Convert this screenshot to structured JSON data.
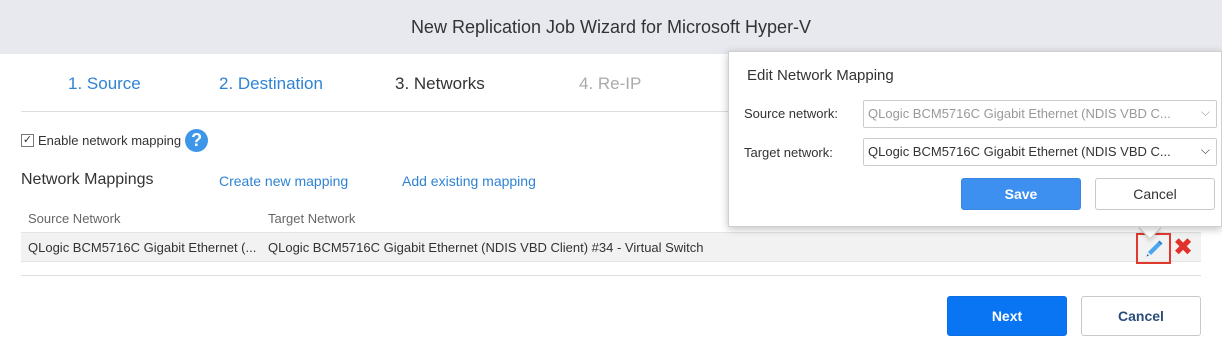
{
  "window": {
    "title": "New Replication Job Wizard for Microsoft Hyper-V"
  },
  "steps": [
    {
      "label": "1. Source",
      "state": "done"
    },
    {
      "label": "2. Destination",
      "state": "done"
    },
    {
      "label": "3. Networks",
      "state": "active"
    },
    {
      "label": "4. Re-IP",
      "state": "disabled"
    }
  ],
  "network_mapping": {
    "enable_label": "Enable network mapping",
    "enabled": true,
    "title": "Network Mappings",
    "create_link": "Create new mapping",
    "add_link": "Add existing mapping",
    "columns": {
      "source": "Source Network",
      "target": "Target Network"
    },
    "rows": [
      {
        "source": "QLogic BCM5716C Gigabit Ethernet (...",
        "target": "QLogic BCM5716C Gigabit Ethernet (NDIS VBD Client) #34 - Virtual Switch"
      }
    ]
  },
  "footer": {
    "next_label": "Next",
    "cancel_label": "Cancel"
  },
  "popup": {
    "title": "Edit Network Mapping",
    "source_label": "Source network:",
    "source_value": "QLogic BCM5716C Gigabit Ethernet (NDIS VBD C...",
    "target_label": "Target network:",
    "target_value": "QLogic BCM5716C Gigabit Ethernet (NDIS VBD C...",
    "save_label": "Save",
    "cancel_label": "Cancel"
  },
  "colors": {
    "accent": "#0a75f2",
    "link": "#2f83d4",
    "danger": "#e0322a",
    "titlebar": "#e7e9ee"
  },
  "icons": [
    "help-icon",
    "pencil-icon",
    "delete-icon",
    "chevron-down-icon",
    "checkmark-icon"
  ]
}
